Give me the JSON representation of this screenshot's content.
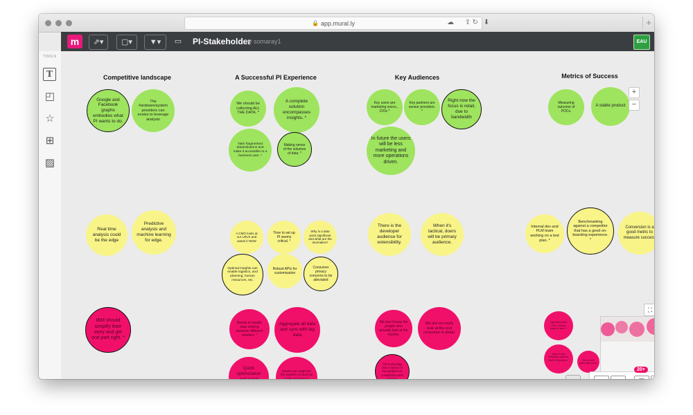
{
  "browser": {
    "url": "app.mural.ly"
  },
  "mural": {
    "title": "PI-Stakeholder",
    "author": "by somaray1",
    "user_initials": "EAU"
  },
  "toolbox": {
    "label": "TOOLS"
  },
  "columns": [
    {
      "title": "Competitive landscape"
    },
    {
      "title": "A Successful PI Experience"
    },
    {
      "title": "Key Audiences"
    },
    {
      "title": "Metrics of Success"
    }
  ],
  "stickies": [
    {
      "text": "Google and Facebook graphs embodies what PI wants to do."
    },
    {
      "text": "The #ardware/system providers can evolve to leverage analysis"
    },
    {
      "text": "We should be collecting ALL THE DATA. *"
    },
    {
      "text": "A complete solution encompasses insights. *"
    },
    {
      "text": "Take fragmented data/solutions and make it accessible to a business user. *"
    },
    {
      "text": "Making sense of the volumes of data. *"
    },
    {
      "text": "Key users are marketing execs., CIOs *"
    },
    {
      "text": "Key partners are sensor providers. *"
    },
    {
      "text": "Right now the focus is retail, due to bandwidth"
    },
    {
      "text": "In future the users will be less marketing and more operations driven."
    },
    {
      "text": "Measuring outcome of POCs."
    },
    {
      "text": "A stable product"
    },
    {
      "text": "Real time analysis could be the edge"
    },
    {
      "text": "Predictive analysis and machine learning for edge."
    },
    {
      "text": "A CMO looks at our UI/UX and wants it NOW"
    },
    {
      "text": "Time to set up PI seems critical. *"
    },
    {
      "text": "Why is a data point significant and what are the anomalies?"
    },
    {
      "text": "Optimal insights can enable logistics, and planning, human resources, etc."
    },
    {
      "text": "Robust APIs for customization"
    },
    {
      "text": "Consumer privacy concerns to be alleviated"
    },
    {
      "text": "There is the developer audience for extensibility."
    },
    {
      "text": "When it's tactical, doers will be primary audience."
    },
    {
      "text": "Internal dev and PLM team working on a test plan. *"
    },
    {
      "text": "Benchmarking against a competitor that has a good on-boarding experience. *"
    },
    {
      "text": "Conversion is a good metric to measure success"
    },
    {
      "text": "IBM should simplify their story and get one part right. *"
    },
    {
      "text": "Needs to handle data sharing between different retailers. *"
    },
    {
      "text": "Aggregate all data and sync with big data"
    },
    {
      "text": "Quick optimization and quick adjustments"
    },
    {
      "text": "Brand can might be the system is used as a DB and data is exported out. *"
    },
    {
      "text": "We don't know the people who actually look at the reports."
    },
    {
      "text": "We did not really look at the end consumer in detail."
    },
    {
      "text": "The technology has a chance of low adoption as consultants need to buy in."
    },
    {
      "text": "Specifics that POC clients want to see. *"
    },
    {
      "text": "Have a live feedback system that is flowing in. *"
    },
    {
      "text": "How is this place right now?"
    }
  ],
  "zoom": {
    "in": "+",
    "out": "−"
  },
  "dock": {
    "badge": "20+"
  },
  "colors": {
    "green": "#9ee45e",
    "yellow": "#f8f488",
    "pink": "#f0106a",
    "brand": "#e8197a"
  }
}
